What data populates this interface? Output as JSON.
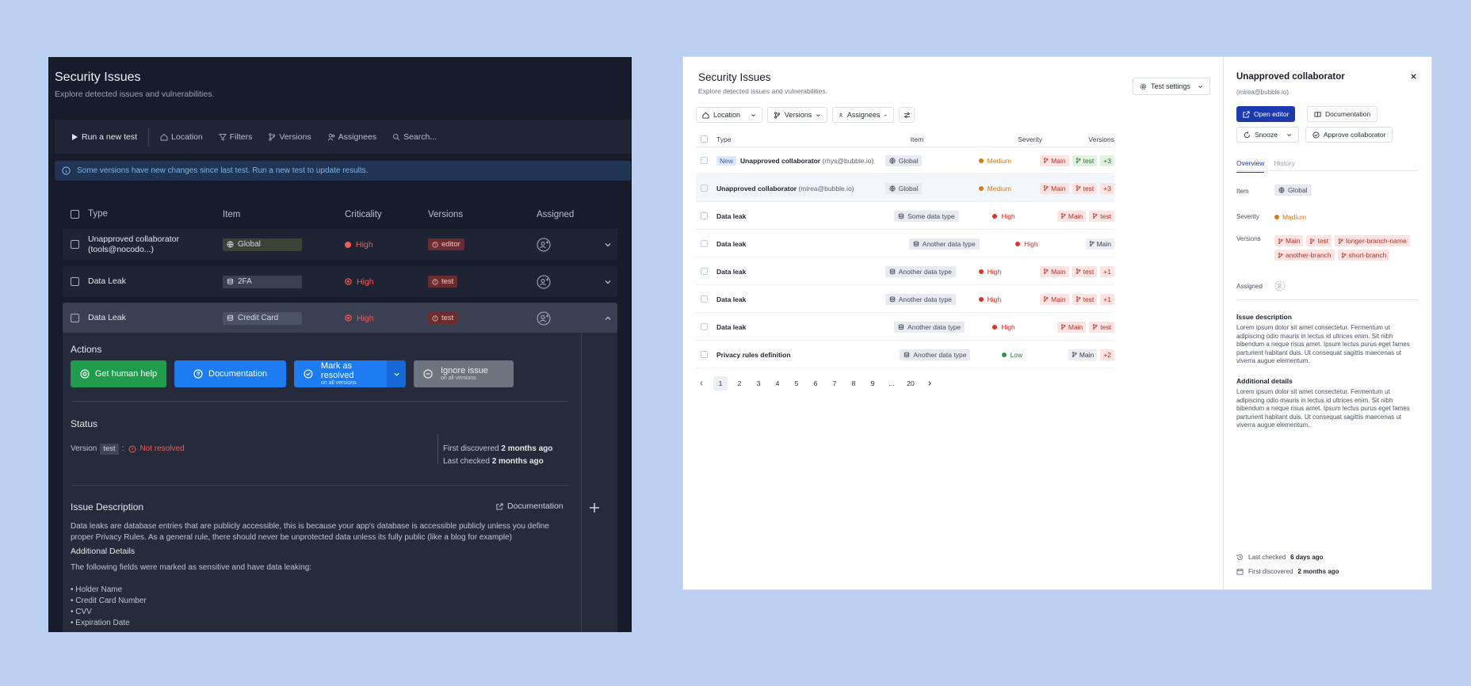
{
  "dark": {
    "title": "Security Issues",
    "subtitle": "Explore detected issues and vulnerabilities.",
    "toolbar": {
      "run": "Run a new test",
      "location": "Location",
      "filters": "Filters",
      "versions": "Versions",
      "assignees": "Assignees",
      "search_placeholder": "Search..."
    },
    "info": "Some versions have new changes since last test. Run a new test to update results.",
    "columns": {
      "type": "Type",
      "item": "Item",
      "criticality": "Criticality",
      "versions": "Versions",
      "assigned": "Assigned"
    },
    "rows": [
      {
        "type_line1": "Unapproved collaborator",
        "type_line2": "(tools@nocodo...)",
        "item": "Global",
        "criticality": "High",
        "version": "editor"
      },
      {
        "type_line1": "Data Leak",
        "item": "2FA",
        "criticality": "High",
        "version": "test"
      },
      {
        "type_line1": "Data Leak",
        "item": "Credit Card",
        "criticality": "High",
        "version": "test"
      }
    ],
    "expanded": {
      "actions_title": "Actions",
      "btn_help": "Get human help",
      "btn_docs": "Documentation",
      "btn_resolve": "Mark as resolved",
      "btn_resolve_sub": "on all versions",
      "btn_ignore": "Ignore issue",
      "btn_ignore_sub": "on all versions",
      "status_title": "Status",
      "version_label": "Version",
      "version_value": "test",
      "version_sep": ":",
      "status_value": "Not resolved",
      "first_discovered_label": "First discovered",
      "first_discovered_value": "2 months ago",
      "last_checked_label": "Last checked",
      "last_checked_value": "2 months ago",
      "desc_title": "Issue Description",
      "desc_link": "Documentation",
      "desc_text": "Data leaks are database entries that are publicly accessible, this is because your app's database is accessible publicly unless you define proper Privacy Rules. As a general rule, there should never be unprotected data unless its fully public (like a blog for example)",
      "details_title": "Additional Details",
      "details_text": "The following fields were marked as sensitive and have data leaking:",
      "fields": [
        "• Holder Name",
        "• Credit Card Number",
        "• CVV",
        "• Expiration Date"
      ]
    }
  },
  "light": {
    "title": "Security Issues",
    "subtitle": "Explore detected issues and vulnerabilities.",
    "test_settings": "Test settings",
    "filters": {
      "location": "Location",
      "versions": "Versions",
      "assignees": "Assignees"
    },
    "columns": {
      "type": "Type",
      "item": "Item",
      "severity": "Severity",
      "versions": "Versions"
    },
    "rows": [
      {
        "badge": "New",
        "type": "Unapproved collaborator",
        "email": "(rhys@bubble.io)",
        "item": "Global",
        "severity": "Medium",
        "v1": "Main",
        "v2": "test",
        "more": "+3"
      },
      {
        "type": "Unapproved collaborator",
        "email": "(mirea@bubble.io)",
        "item": "Global",
        "severity": "Medium",
        "v1": "Main",
        "v2": "test",
        "more": "+3"
      },
      {
        "type": "Data leak",
        "item": "Some data type",
        "severity": "High",
        "v1": "Main",
        "v2": "test"
      },
      {
        "type": "Data leak",
        "item": "Another data type",
        "severity": "High",
        "v1": "Main"
      },
      {
        "type": "Data leak",
        "item": "Another data type",
        "severity": "High",
        "v1": "Main",
        "v2": "test",
        "more": "+1"
      },
      {
        "type": "Data leak",
        "item": "Another data type",
        "severity": "High",
        "v1": "Main",
        "v2": "test",
        "more": "+1"
      },
      {
        "type": "Data leak",
        "item": "Another data type",
        "severity": "High",
        "v1": "Main",
        "v2": "test"
      },
      {
        "type": "Privacy rules definition",
        "item": "Another data type",
        "severity": "Low",
        "v1": "Main",
        "more": "+2"
      }
    ],
    "pages": [
      "1",
      "2",
      "3",
      "4",
      "5",
      "6",
      "7",
      "8",
      "9",
      "...",
      "20"
    ],
    "side": {
      "name": "Unapproved collaborator",
      "email": "(mirea@bubble.io)",
      "open_editor": "Open editor",
      "documentation": "Documentation",
      "snooze": "Snooze",
      "approve": "Approve collaborator",
      "tab_overview": "Overview",
      "tab_history": "History",
      "item_label": "Item",
      "item_value": "Global",
      "severity_label": "Severity",
      "severity_value": "Medium",
      "versions_label": "Versions",
      "versions": [
        "Main",
        "test",
        "longer-branch-name",
        "another-branch",
        "short-branch"
      ],
      "assigned_label": "Assigned",
      "issue_desc_title": "Issue description",
      "issue_desc": "Lorem ipsum dolor sit amet consectetur. Fermentum ut adipiscing odio mauris in lectus id ultrices enim. Sit nibh bibendum a neque risus amet. Ipsum lectus purus eget fames parturient habitant duis. Ut consequat sagittis maecenas ut viverra augue elementum.",
      "add_details_title": "Additional details",
      "add_details": "Lorem ipsum dolor sit amet consectetur. Fermentum ut adipiscing odio mauris in lectus id ultrices enim. Sit nibh bibendum a neque risus amet. Ipsum lectus purus eget fames parturient habitant duis. Ut consequat sagittis maecenas ut viverra augue elementum.",
      "last_checked_label": "Last checked",
      "last_checked_value": "6 days ago",
      "first_discovered_label": "First discovered",
      "first_discovered_value": "2 months ago"
    }
  },
  "colors": {
    "dark_bg": "#171c2b",
    "accent_blue": "#1d39b0",
    "danger": "#ef5b5b",
    "medium": "#d97a0f",
    "low": "#2c9a3e",
    "page_bg": "#bcd1f2"
  }
}
